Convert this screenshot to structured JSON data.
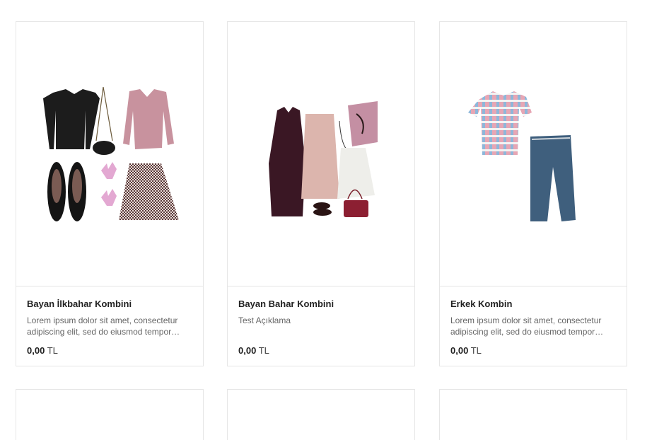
{
  "products": [
    {
      "title": "Bayan İlkbahar Kombini",
      "description": "Lorem ipsum dolor sit amet, consectetur adipiscing elit, sed do eiusmod tempor…",
      "price": "0,00",
      "currency": "TL"
    },
    {
      "title": "Bayan Bahar Kombini",
      "description": "Test Açıklama",
      "price": "0,00",
      "currency": "TL"
    },
    {
      "title": "Erkek Kombin",
      "description": "Lorem ipsum dolor sit amet, consectetur adipiscing elit, sed do eiusmod tempor…",
      "price": "0,00",
      "currency": "TL"
    }
  ]
}
